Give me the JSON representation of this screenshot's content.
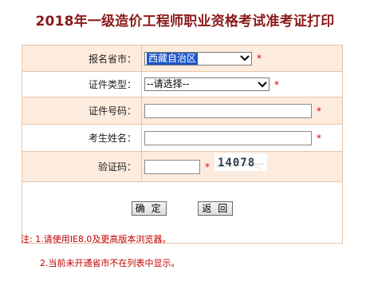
{
  "page": {
    "title": "2018年一级造价工程师职业资格考试准考证打印"
  },
  "form": {
    "province_label": "报名省市：",
    "province_value": "西藏自治区",
    "idtype_label": "证件类型：",
    "idtype_value": "--请选择--",
    "idnum_label": "证件号码：",
    "idnum_value": "",
    "name_label": "考生姓名：",
    "name_value": "",
    "captcha_label": "验证码：",
    "captcha_value": "",
    "captcha_text": "14078",
    "required_mark": "*"
  },
  "buttons": {
    "confirm": "确 定",
    "back": "返 回"
  },
  "notes": {
    "line1": "注: 1.请使用IE8.0及更高版本浏览器。",
    "line2": "2.当前未开通省市不在列表中显示。"
  },
  "colors": {
    "title": "#8b1a1a",
    "row_bg": "#fdebde",
    "required": "#e00000",
    "note": "#c00000",
    "selected": "#1e55c8"
  }
}
